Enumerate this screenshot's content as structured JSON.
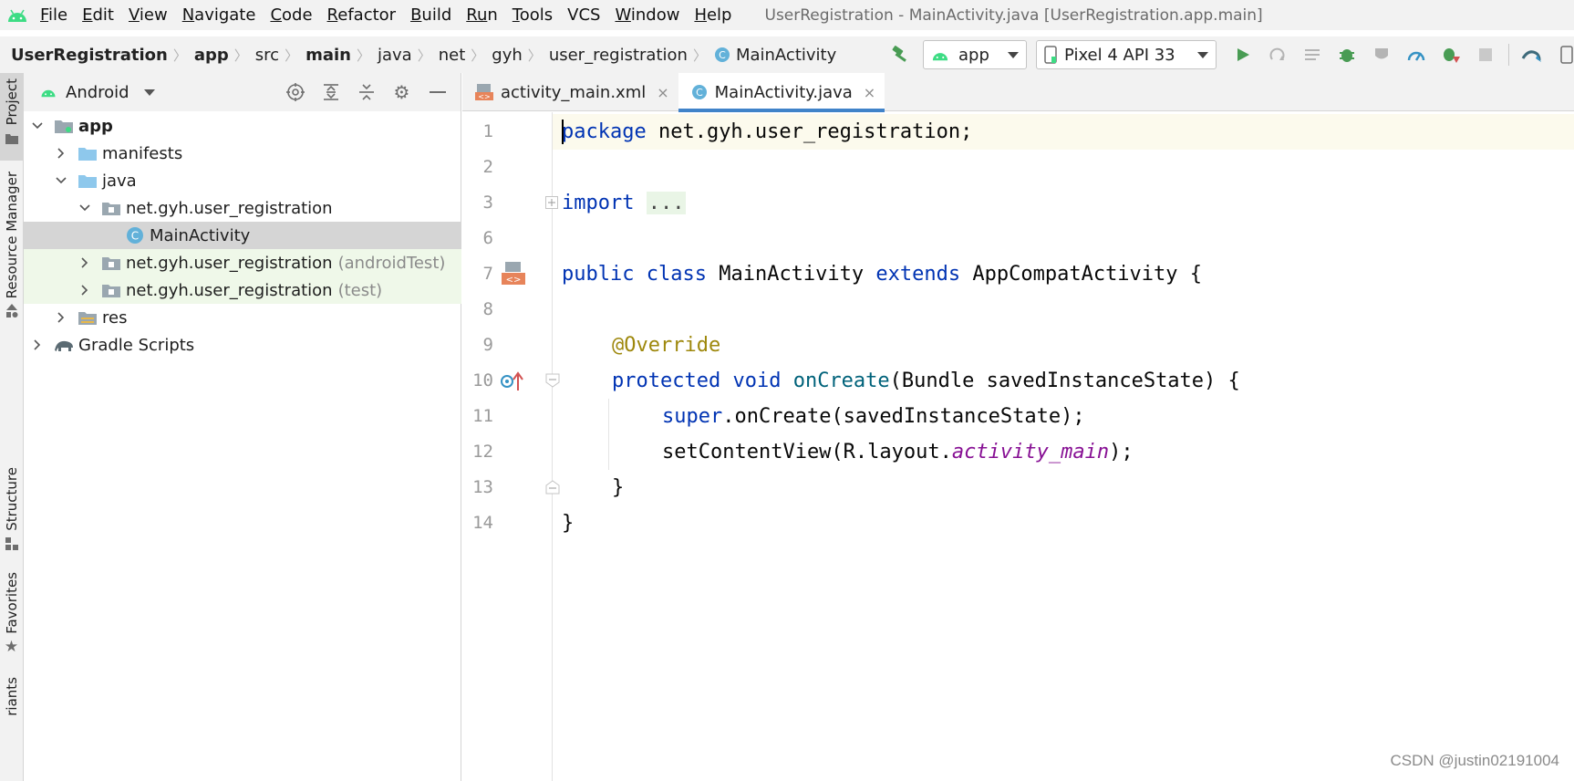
{
  "menubar": {
    "items": [
      {
        "u": "F",
        "rest": "ile"
      },
      {
        "u": "E",
        "rest": "dit"
      },
      {
        "u": "V",
        "rest": "iew"
      },
      {
        "u": "N",
        "rest": "avigate"
      },
      {
        "u": "C",
        "rest": "ode"
      },
      {
        "u": "R",
        "rest": "efactor"
      },
      {
        "u": "B",
        "rest": "uild"
      },
      {
        "u": "Ru",
        "rest": "n",
        "pre": "R",
        "plain": true
      },
      {
        "u": "T",
        "rest": "ools"
      },
      {
        "u": "",
        "rest": "VCS"
      },
      {
        "u": "W",
        "rest": "indow"
      },
      {
        "u": "H",
        "rest": "elp"
      }
    ],
    "window_title": "UserRegistration - MainActivity.java [UserRegistration.app.main]"
  },
  "breadcrumb": {
    "items": [
      "UserRegistration",
      "app",
      "src",
      "main",
      "java",
      "net",
      "gyh",
      "user_registration",
      "MainActivity"
    ]
  },
  "toolbar": {
    "config": "app",
    "device": "Pixel 4 API 33"
  },
  "stripe": {
    "project": "Project",
    "resource_manager": "Resource Manager",
    "structure": "Structure",
    "favorites": "Favorites",
    "variants": "riants"
  },
  "project_panel": {
    "view": "Android",
    "tree": [
      {
        "label": "app",
        "suffix": ""
      },
      {
        "label": "manifests",
        "suffix": ""
      },
      {
        "label": "java",
        "suffix": ""
      },
      {
        "label": "net.gyh.user_registration",
        "suffix": ""
      },
      {
        "label": "MainActivity",
        "suffix": ""
      },
      {
        "label": "net.gyh.user_registration",
        "suffix": "(androidTest)"
      },
      {
        "label": "net.gyh.user_registration",
        "suffix": "(test)"
      },
      {
        "label": "res",
        "suffix": ""
      },
      {
        "label": "Gradle Scripts",
        "suffix": ""
      }
    ]
  },
  "editor": {
    "tabs": [
      {
        "label": "activity_main.xml",
        "close": "×"
      },
      {
        "label": "MainActivity.java",
        "close": "×"
      }
    ],
    "line_numbers": [
      "1",
      "2",
      "3",
      "6",
      "7",
      "8",
      "9",
      "10",
      "11",
      "12",
      "13",
      "14"
    ],
    "code": {
      "l1_kw": "package",
      "l1_rest": " net.gyh.user_registration;",
      "l3_kw": "import",
      "l3_fold": "...",
      "l7_kw1": "public",
      "l7_kw2": "class",
      "l7_name": " MainActivity ",
      "l7_kw3": "extends",
      "l7_rest": " AppCompatActivity {",
      "l9_ann": "@Override",
      "l10_kw1": "protected",
      "l10_kw2": "void",
      "l10_fn": "onCreate",
      "l10_rest": "(Bundle savedInstanceState) {",
      "l11_kw": "super",
      "l11_rest": ".onCreate(savedInstanceState);",
      "l12_pre": "setContentView(R.layout.",
      "l12_it": "activity_main",
      "l12_post": ");",
      "l13": "}",
      "l14": "}"
    }
  },
  "watermark": "CSDN @justin02191004",
  "colors": {
    "keyword": "#0033b3",
    "annotation": "#9e880d",
    "method": "#00627a",
    "field_italic": "#871094",
    "accent": "#4083c9",
    "android_green": "#3ddc84"
  }
}
